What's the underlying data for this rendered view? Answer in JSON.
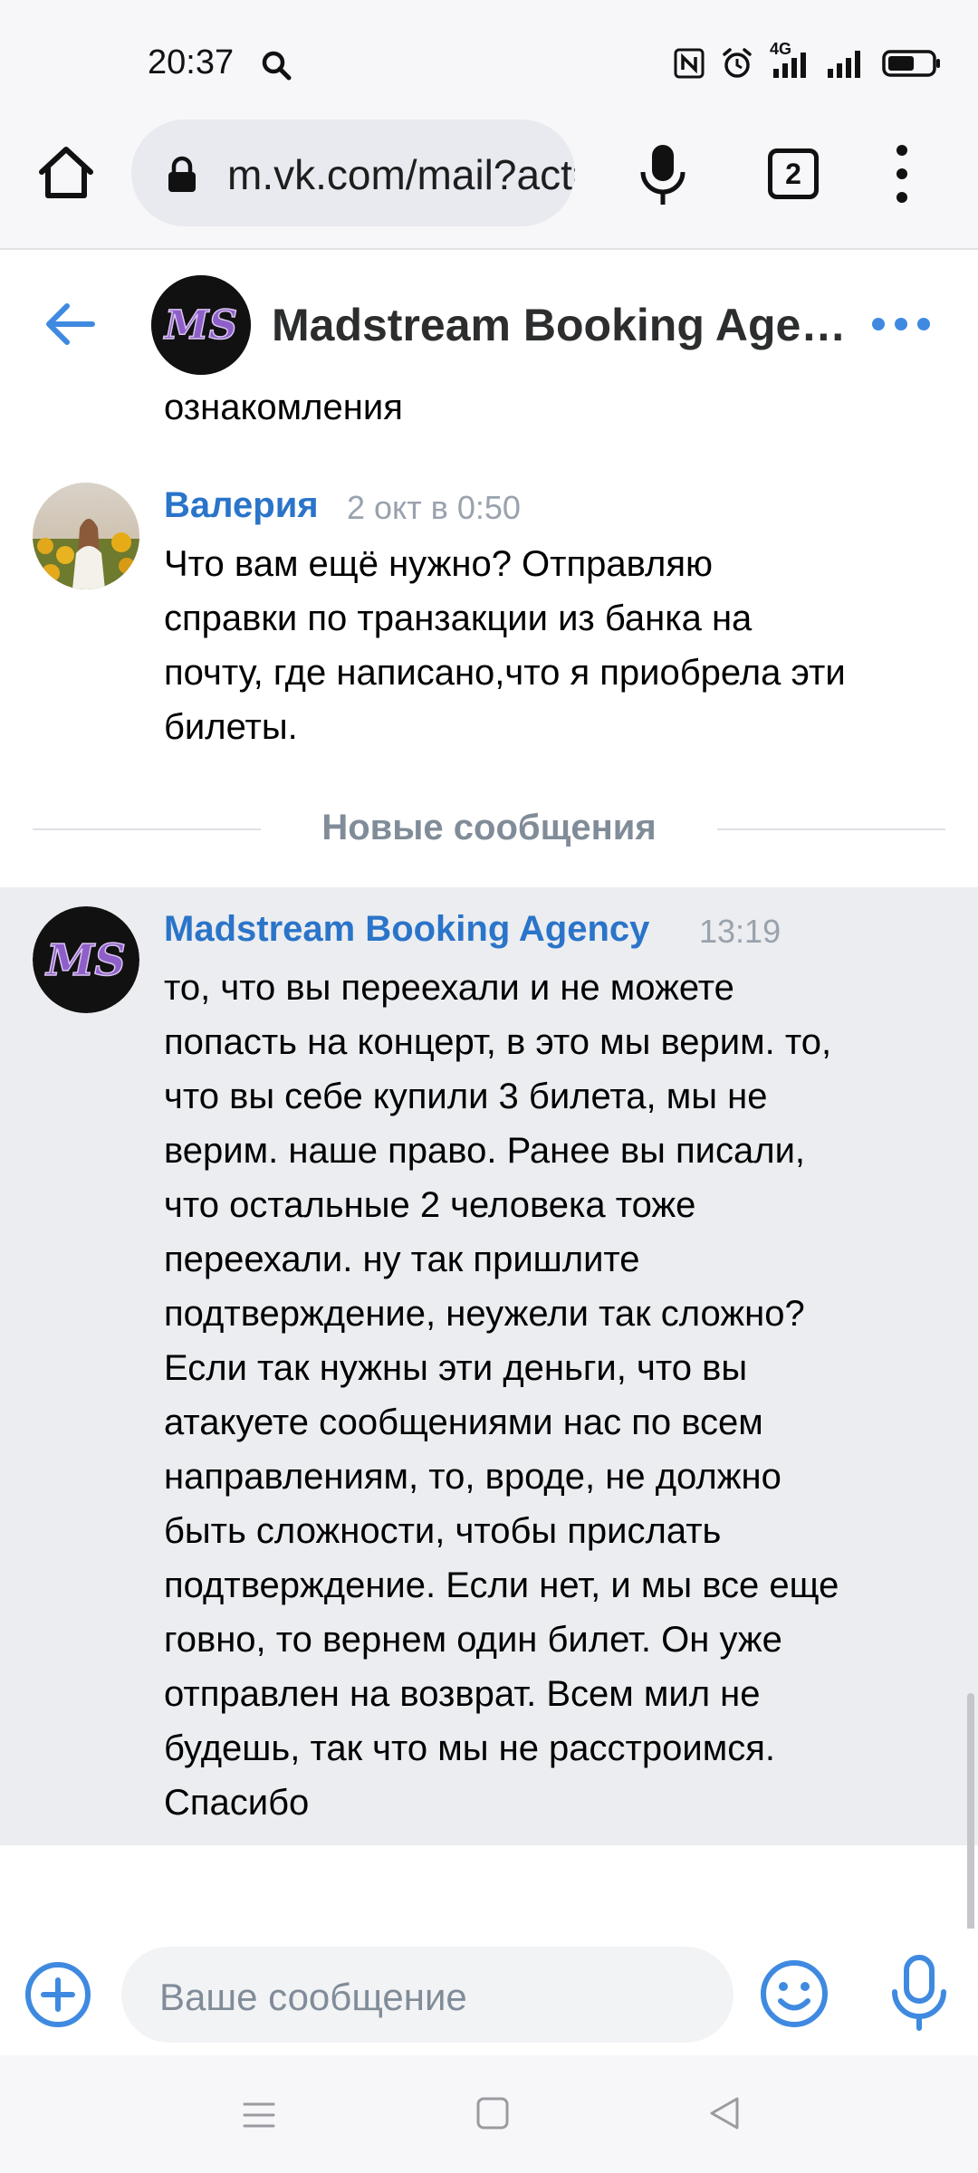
{
  "status_bar": {
    "time": "20:37",
    "network": "4G"
  },
  "browser": {
    "url": "m.vk.com/mail?act=show",
    "tab_count": "2"
  },
  "chat": {
    "title": "Madstream Booking Agency",
    "title_display": "Madstream Booking Age…",
    "avatar_text": "MS"
  },
  "messages": {
    "continued": "ознакомления",
    "m1": {
      "author": "Валерия",
      "time": "2 окт в 0:50",
      "lines": [
        "Что вам ещё нужно? Отправляю",
        "справки по транзакции из банка на",
        "почту, где написано,что я приобрела эти",
        "билеты."
      ]
    },
    "new_divider": "Новые сообщения",
    "m2": {
      "author": "Madstream Booking Agency",
      "time": "13:19",
      "lines": [
        "то, что вы переехали и не можете",
        "попасть на концерт, в это мы верим. то,",
        "что вы себе купили 3 билета, мы не",
        "верим. наше право. Ранее вы писали,",
        "что остальные 2 человека тоже",
        "переехали. ну так пришлите",
        "подтверждение, неужели так сложно?",
        "Если так нужны эти деньги, что вы",
        "атакуете сообщениями нас по всем",
        "направлениям, то, вроде, не должно",
        "быть сложности, чтобы прислать",
        "подтверждение. Если нет, и мы все еще",
        "говно, то вернем один билет. Он уже",
        "отправлен на возврат. Всем мил не",
        "будешь, так что мы не расстроимся.",
        "Спасибо"
      ]
    }
  },
  "composer": {
    "placeholder": "Ваше сообщение"
  },
  "colors": {
    "accent": "#2a74c9",
    "icon_blue": "#3f8ae0",
    "new_bg": "#ebedf0",
    "muted": "#818c99"
  }
}
